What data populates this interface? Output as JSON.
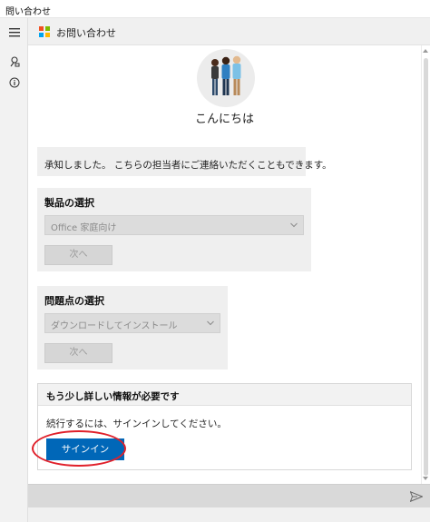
{
  "window": {
    "title": "問い合わせ"
  },
  "header": {
    "app_title": "お問い合わせ"
  },
  "microsoft_logo_colors": [
    "#f25022",
    "#7fba00",
    "#00a4ef",
    "#ffb900"
  ],
  "hero": {
    "greeting": "こんにちは"
  },
  "chat": {
    "bot_message": "承知しました。 こちらの担当者にご連絡いただくこともできます。"
  },
  "product_card": {
    "title": "製品の選択",
    "selected": "Office 家庭向け",
    "next_label": "次へ"
  },
  "issue_card": {
    "title": "問題点の選択",
    "selected": "ダウンロードしてインストール",
    "next_label": "次へ"
  },
  "signin_card": {
    "title": "もう少し詳しい情報が必要です",
    "message": "続行するには、サインインしてください。",
    "button_label": "サインイン"
  },
  "accent_color": "#0067b8",
  "highlight_color": "#e0202a",
  "icons": {
    "menu": "hamburger-menu-icon",
    "feedback": "feedback-icon",
    "info": "info-icon",
    "send": "send-icon"
  }
}
